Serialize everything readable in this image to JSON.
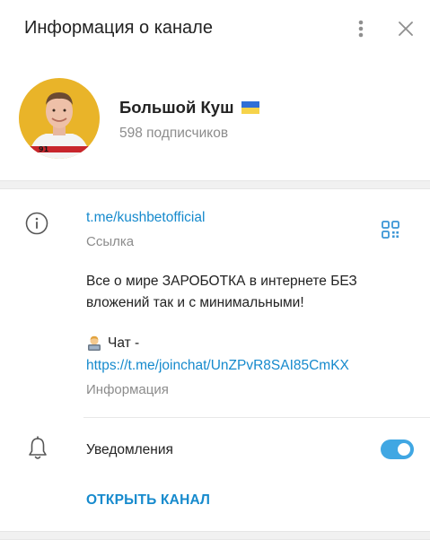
{
  "header": {
    "title": "Информация о канале",
    "more_icon": "more-vertical-icon",
    "close_icon": "close-icon"
  },
  "profile": {
    "name": "Большой Куш",
    "flag": "ukraine-flag-emoji",
    "subscribers": "598 подписчиков"
  },
  "info": {
    "link": "t.me/kushbetofficial",
    "link_caption": "Ссылка",
    "description_lines": [
      "Все о мире ЗАРОБОТКА в интернете БЕЗ",
      "вложений так и с минимальными!"
    ],
    "chat_emoji": "technologist-emoji",
    "chat_label": "Чат -",
    "chat_link": "https://t.me/joinchat/UnZPvR8SAI85CmKX",
    "info_caption": "Информация"
  },
  "notifications": {
    "label": "Уведомления",
    "enabled": true
  },
  "actions": {
    "open_channel": "ОТКРЫТЬ КАНАЛ"
  },
  "colors": {
    "accent": "#168acd",
    "toggle": "#40a7e3",
    "avatar_bg": "#e9b429",
    "muted": "#8c8c8c"
  }
}
